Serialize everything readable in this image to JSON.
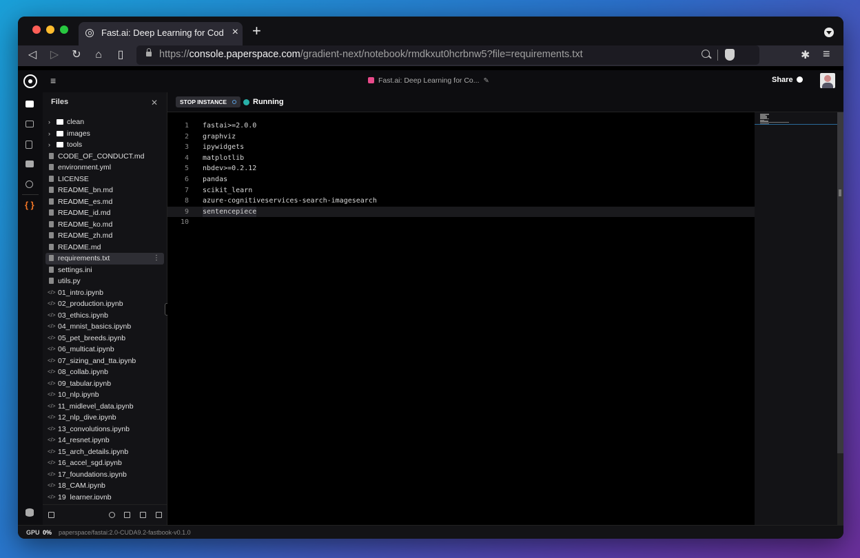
{
  "browser": {
    "tab_title": "Fast.ai: Deep Learning for Coders",
    "url_scheme": "https://",
    "url_host": "console.paperspace.com",
    "url_path": "/gradient-next/notebook/rmdkxut0hcrbnw5?file=requirements.txt"
  },
  "app": {
    "notebook_title": "Fast.ai: Deep Learning for Co...",
    "share_label": "Share"
  },
  "file_panel": {
    "title": "Files",
    "items": [
      {
        "label": "clean",
        "kind": "folder"
      },
      {
        "label": "images",
        "kind": "folder"
      },
      {
        "label": "tools",
        "kind": "folder"
      },
      {
        "label": "CODE_OF_CONDUCT.md",
        "kind": "file"
      },
      {
        "label": "environment.yml",
        "kind": "file"
      },
      {
        "label": "LICENSE",
        "kind": "file"
      },
      {
        "label": "README_bn.md",
        "kind": "file"
      },
      {
        "label": "README_es.md",
        "kind": "file"
      },
      {
        "label": "README_id.md",
        "kind": "file"
      },
      {
        "label": "README_ko.md",
        "kind": "file"
      },
      {
        "label": "README_zh.md",
        "kind": "file"
      },
      {
        "label": "README.md",
        "kind": "file"
      },
      {
        "label": "requirements.txt",
        "kind": "file",
        "selected": true
      },
      {
        "label": "settings.ini",
        "kind": "file"
      },
      {
        "label": "utils.py",
        "kind": "file"
      },
      {
        "label": "01_intro.ipynb",
        "kind": "notebook"
      },
      {
        "label": "02_production.ipynb",
        "kind": "notebook"
      },
      {
        "label": "03_ethics.ipynb",
        "kind": "notebook"
      },
      {
        "label": "04_mnist_basics.ipynb",
        "kind": "notebook"
      },
      {
        "label": "05_pet_breeds.ipynb",
        "kind": "notebook"
      },
      {
        "label": "06_multicat.ipynb",
        "kind": "notebook"
      },
      {
        "label": "07_sizing_and_tta.ipynb",
        "kind": "notebook"
      },
      {
        "label": "08_collab.ipynb",
        "kind": "notebook"
      },
      {
        "label": "09_tabular.ipynb",
        "kind": "notebook"
      },
      {
        "label": "10_nlp.ipynb",
        "kind": "notebook"
      },
      {
        "label": "11_midlevel_data.ipynb",
        "kind": "notebook"
      },
      {
        "label": "12_nlp_dive.ipynb",
        "kind": "notebook"
      },
      {
        "label": "13_convolutions.ipynb",
        "kind": "notebook"
      },
      {
        "label": "14_resnet.ipynb",
        "kind": "notebook"
      },
      {
        "label": "15_arch_details.ipynb",
        "kind": "notebook"
      },
      {
        "label": "16_accel_sgd.ipynb",
        "kind": "notebook"
      },
      {
        "label": "17_foundations.ipynb",
        "kind": "notebook"
      },
      {
        "label": "18_CAM.ipynb",
        "kind": "notebook"
      },
      {
        "label": "19_learner.ipynb",
        "kind": "notebook"
      }
    ]
  },
  "instance": {
    "stop_label": "STOP INSTANCE",
    "status": "Running",
    "status_color": "#28b0a8"
  },
  "editor": {
    "active_line": 9,
    "lines": [
      "fastai>=2.0.0",
      "graphviz",
      "ipywidgets",
      "matplotlib",
      "nbdev>=0.2.12",
      "pandas",
      "scikit_learn",
      "azure-cognitiveservices-search-imagesearch",
      "sentencepiece",
      ""
    ]
  },
  "statusbar": {
    "gpu_label": "GPU",
    "gpu_value": "0%",
    "container": "paperspace/fastai:2.0-CUDA9.2-fastbook-v0.1.0"
  }
}
